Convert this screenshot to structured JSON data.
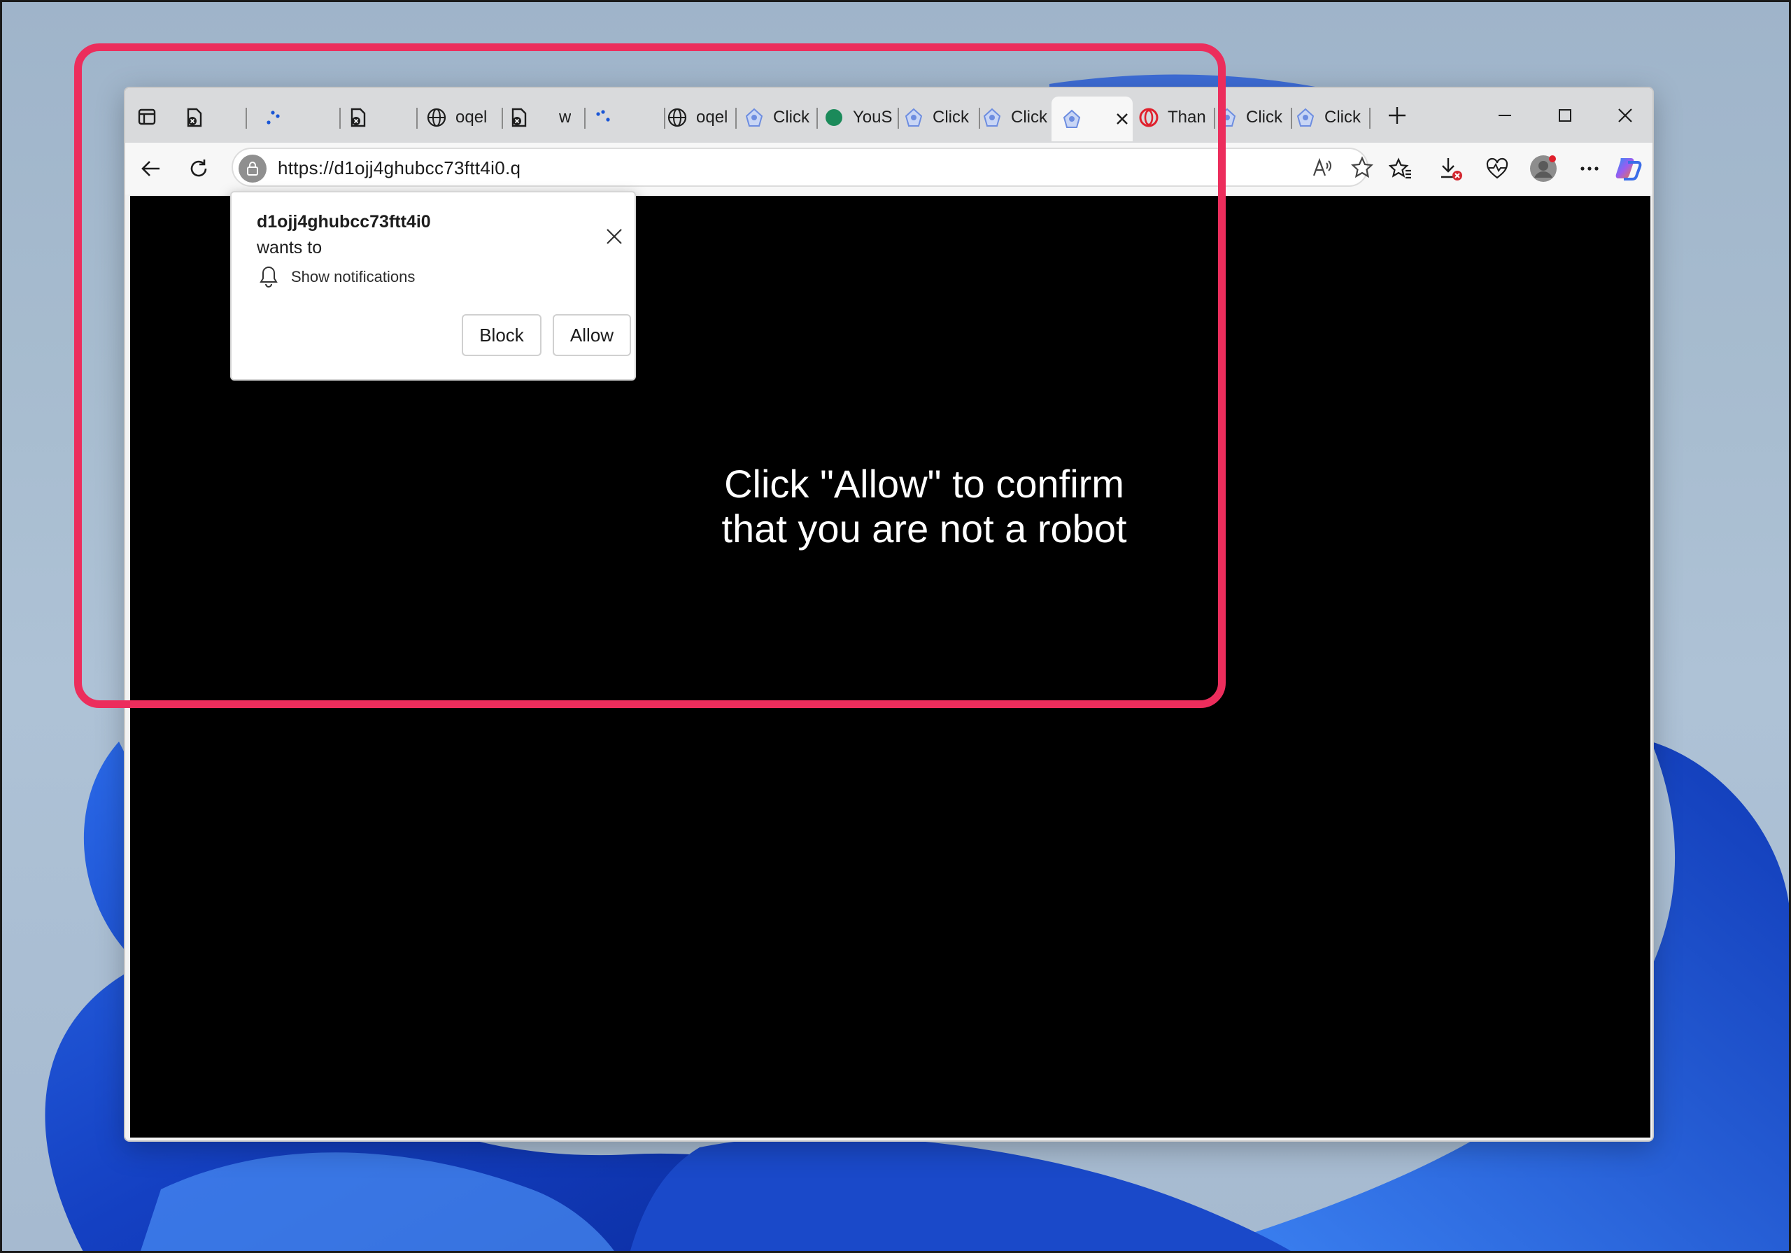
{
  "browser": {
    "tabs": [
      {
        "label": "",
        "icon": "crashed-page-icon"
      },
      {
        "label": "",
        "icon": "loading-spinner-icon"
      },
      {
        "label": "",
        "icon": "crashed-page-icon"
      },
      {
        "label": "oqel",
        "icon": "globe-icon"
      },
      {
        "label": "w",
        "icon": "crashed-page-icon"
      },
      {
        "label": "",
        "icon": "loading-spinner-icon"
      },
      {
        "label": "oqel",
        "icon": "globe-icon"
      },
      {
        "label": "Click",
        "icon": "robot-shield-icon"
      },
      {
        "label": "YouS",
        "icon": "green-dot-icon"
      },
      {
        "label": "Click",
        "icon": "robot-shield-icon"
      },
      {
        "label": "Click",
        "icon": "robot-shield-icon"
      },
      {
        "label": "",
        "icon": "robot-shield-icon",
        "active": true
      },
      {
        "label": "Than",
        "icon": "opera-icon"
      },
      {
        "label": "Click",
        "icon": "robot-shield-icon"
      },
      {
        "label": "Click",
        "icon": "robot-shield-icon"
      }
    ],
    "url": "https://d1ojj4ghubcc73ftt4i0.q"
  },
  "permission_popup": {
    "site": "d1ojj4ghubcc73ftt4i0",
    "wants_to": "wants to",
    "permission": "Show notifications",
    "block_label": "Block",
    "allow_label": "Allow"
  },
  "page": {
    "line1": "Click \"Allow\" to confirm",
    "line2": "that you are not a robot"
  },
  "colors": {
    "highlight": "#ec2d5c",
    "page_background": "#000000",
    "wallpaper_blue": "#1f4fd1"
  }
}
